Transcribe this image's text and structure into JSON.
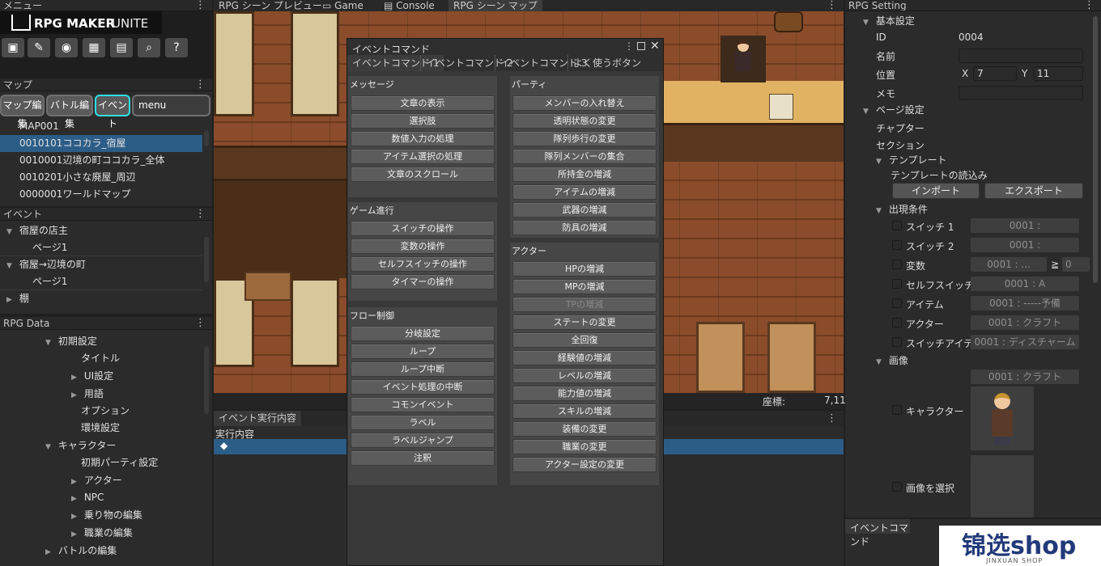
{
  "menu_panel": {
    "title": "メニュー",
    "logo_text": "RPG MAKER",
    "logo_unite": "UNITE"
  },
  "map_panel": {
    "title": "マップ",
    "tabs": [
      "マップ編集",
      "バトル編集",
      "イベント"
    ],
    "search_value": "menu",
    "items": [
      "MAP001",
      "0010101ココカラ_宿屋",
      "0010001辺境の町ココカラ_全体",
      "0010201小さな廃屋_周辺",
      "0000001ワールドマップ"
    ]
  },
  "event_panel": {
    "title": "イベント",
    "items": [
      {
        "label": "宿屋の店主",
        "tri": "▼"
      },
      {
        "label": "ページ1",
        "tri": ""
      },
      {
        "label": "宿屋→辺境の町",
        "tri": "▼"
      },
      {
        "label": "ページ1",
        "tri": ""
      },
      {
        "label": "棚",
        "tri": "▶"
      }
    ]
  },
  "rpg_data": {
    "title": "RPG Data",
    "items": [
      {
        "label": "初期設定",
        "tri": "▼"
      },
      {
        "label": "タイトル",
        "tri": ""
      },
      {
        "label": "UI設定",
        "tri": "▶"
      },
      {
        "label": "用語",
        "tri": "▶"
      },
      {
        "label": "オプション",
        "tri": ""
      },
      {
        "label": "環境設定",
        "tri": ""
      },
      {
        "label": "キャラクター",
        "tri": "▼"
      },
      {
        "label": "初期パーティ設定",
        "tri": ""
      },
      {
        "label": "アクター",
        "tri": "▶"
      },
      {
        "label": "NPC",
        "tri": "▶"
      },
      {
        "label": "乗り物の編集",
        "tri": "▶"
      },
      {
        "label": "職業の編集",
        "tri": "▶"
      },
      {
        "label": "バトルの編集",
        "tri": "▶"
      }
    ]
  },
  "center_tabs": [
    "RPG シーン プレビュー",
    "Game",
    "Console",
    "RPG シーン マップ"
  ],
  "coords": {
    "label": "座標:",
    "value": "7,11"
  },
  "exec_panel": {
    "title": "イベント実行内容",
    "header": "実行内容",
    "row_symbol": "◆"
  },
  "event_command": {
    "title": "イベントコマンド",
    "tabs": [
      "イベントコマンド 1",
      "イベントコマンド 2",
      "イベントコマンド 3",
      "よく使うボタン"
    ],
    "groups": {
      "message": {
        "title": "メッセージ",
        "buttons": [
          "文章の表示",
          "選択肢",
          "数値入力の処理",
          "アイテム選択の処理",
          "文章のスクロール"
        ]
      },
      "game": {
        "title": "ゲーム進行",
        "buttons": [
          "スイッチの操作",
          "変数の操作",
          "セルフスイッチの操作",
          "タイマーの操作"
        ]
      },
      "flow": {
        "title": "フロー制御",
        "buttons": [
          "分岐設定",
          "ループ",
          "ループ中断",
          "イベント処理の中断",
          "コモンイベント",
          "ラベル",
          "ラベルジャンプ",
          "注釈"
        ]
      },
      "party": {
        "title": "パーティ",
        "buttons": [
          "メンバーの入れ替え",
          "透明状態の変更",
          "隊列歩行の変更",
          "隊列メンバーの集合",
          "所持金の増減",
          "アイテムの増減",
          "武器の増減",
          "防具の増減"
        ]
      },
      "actor": {
        "title": "アクター",
        "buttons": [
          "HPの増減",
          "MPの増減",
          "TPの増減",
          "ステートの変更",
          "全回復",
          "経験値の増減",
          "レベルの増減",
          "能力値の増減",
          "スキルの増減",
          "装備の変更",
          "職業の変更",
          "アクター設定の変更"
        ]
      }
    }
  },
  "rpg_setting": {
    "title": "RPG Setting",
    "basic": "基本設定",
    "id_label": "ID",
    "id_value": "0004",
    "name_label": "名前",
    "name_value": "",
    "pos_label": "位置",
    "x_label": "X",
    "x_value": "7",
    "y_label": "Y",
    "y_value": "11",
    "memo_label": "メモ",
    "memo_value": "",
    "page_settings": "ページ設定",
    "chapter": "チャプター",
    "section": "セクション",
    "template": "テンプレート",
    "template_load": "テンプレートの読込み",
    "import": "インポート",
    "export": "エクスポート",
    "conditions": "出現条件",
    "switch1": "スイッチ 1",
    "switch1_val": "0001 :",
    "switch2": "スイッチ 2",
    "switch2_val": "0001 :",
    "variable": "変数",
    "variable_val": "0001 : ...",
    "ge": "≧",
    "variable_num": "0",
    "selfswitch": "セルフスイッチ",
    "selfswitch_val": "0001 : A",
    "item": "アイテム",
    "item_val": "0001 : -----予備",
    "actor": "アクター",
    "actor_val": "0001 : クラフト",
    "switchitem": "スイッチアイテム",
    "switchitem_val": "0001 : ディスチャーム",
    "image": "画像",
    "image_val": "0001 : クラフト",
    "character": "キャラクター",
    "select_image": "画像を選択"
  },
  "bottom_right": {
    "title": "イベントコマンド"
  },
  "watermark": {
    "brand": "锦选shop",
    "sub": "JINXUAN SHOP"
  }
}
